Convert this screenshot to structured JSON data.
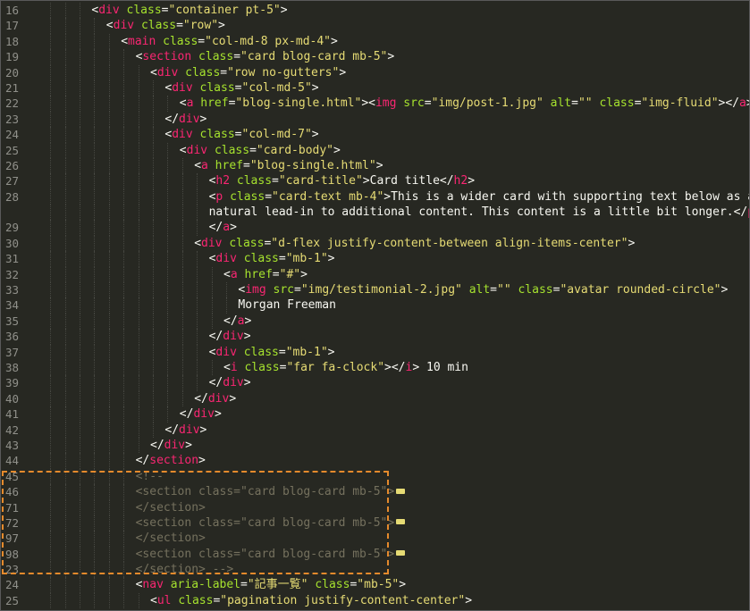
{
  "editor": {
    "lines": [
      {
        "num": "16",
        "indent": 7,
        "segments": [
          [
            "text",
            "<"
          ],
          [
            "tag",
            "div"
          ],
          [
            "text",
            " "
          ],
          [
            "attr",
            "class"
          ],
          [
            "text",
            "="
          ],
          [
            "str",
            "\"container pt-5\""
          ],
          [
            "text",
            ">"
          ]
        ]
      },
      {
        "num": "17",
        "indent": 9,
        "segments": [
          [
            "text",
            "<"
          ],
          [
            "tag",
            "div"
          ],
          [
            "text",
            " "
          ],
          [
            "attr",
            "class"
          ],
          [
            "text",
            "="
          ],
          [
            "str",
            "\"row\""
          ],
          [
            "text",
            ">"
          ]
        ]
      },
      {
        "num": "18",
        "indent": 11,
        "segments": [
          [
            "text",
            "<"
          ],
          [
            "tag",
            "main"
          ],
          [
            "text",
            " "
          ],
          [
            "attr",
            "class"
          ],
          [
            "text",
            "="
          ],
          [
            "str",
            "\"col-md-8 px-md-4\""
          ],
          [
            "text",
            ">"
          ]
        ]
      },
      {
        "num": "19",
        "indent": 13,
        "segments": [
          [
            "text",
            "<"
          ],
          [
            "tag",
            "section"
          ],
          [
            "text",
            " "
          ],
          [
            "attr",
            "class"
          ],
          [
            "text",
            "="
          ],
          [
            "str",
            "\"card blog-card mb-5\""
          ],
          [
            "text",
            ">"
          ]
        ]
      },
      {
        "num": "20",
        "indent": 15,
        "segments": [
          [
            "text",
            "<"
          ],
          [
            "tag",
            "div"
          ],
          [
            "text",
            " "
          ],
          [
            "attr",
            "class"
          ],
          [
            "text",
            "="
          ],
          [
            "str",
            "\"row no-gutters\""
          ],
          [
            "text",
            ">"
          ]
        ]
      },
      {
        "num": "21",
        "indent": 17,
        "segments": [
          [
            "text",
            "<"
          ],
          [
            "tag",
            "div"
          ],
          [
            "text",
            " "
          ],
          [
            "attr",
            "class"
          ],
          [
            "text",
            "="
          ],
          [
            "str",
            "\"col-md-5\""
          ],
          [
            "text",
            ">"
          ]
        ]
      },
      {
        "num": "22",
        "indent": 19,
        "segments": [
          [
            "text",
            "<"
          ],
          [
            "tag",
            "a"
          ],
          [
            "text",
            " "
          ],
          [
            "attr",
            "href"
          ],
          [
            "text",
            "="
          ],
          [
            "str",
            "\"blog-single.html\""
          ],
          [
            "text",
            ">"
          ],
          [
            "text",
            "<"
          ],
          [
            "tag",
            "img"
          ],
          [
            "text",
            " "
          ],
          [
            "attr",
            "src"
          ],
          [
            "text",
            "="
          ],
          [
            "str",
            "\"img/post-1.jpg\""
          ],
          [
            "text",
            " "
          ],
          [
            "attr",
            "alt"
          ],
          [
            "text",
            "="
          ],
          [
            "str",
            "\"\""
          ],
          [
            "text",
            " "
          ],
          [
            "attr",
            "class"
          ],
          [
            "text",
            "="
          ],
          [
            "str",
            "\"img-fluid\""
          ],
          [
            "text",
            ">"
          ],
          [
            "text",
            "</"
          ],
          [
            "tag",
            "a"
          ],
          [
            "text",
            ">"
          ]
        ]
      },
      {
        "num": "23",
        "indent": 17,
        "segments": [
          [
            "text",
            "</"
          ],
          [
            "tag",
            "div"
          ],
          [
            "text",
            ">"
          ]
        ]
      },
      {
        "num": "24",
        "indent": 17,
        "segments": [
          [
            "text",
            "<"
          ],
          [
            "tag",
            "div"
          ],
          [
            "text",
            " "
          ],
          [
            "attr",
            "class"
          ],
          [
            "text",
            "="
          ],
          [
            "str",
            "\"col-md-7\""
          ],
          [
            "text",
            ">"
          ]
        ]
      },
      {
        "num": "25",
        "indent": 19,
        "segments": [
          [
            "text",
            "<"
          ],
          [
            "tag",
            "div"
          ],
          [
            "text",
            " "
          ],
          [
            "attr",
            "class"
          ],
          [
            "text",
            "="
          ],
          [
            "str",
            "\"card-body\""
          ],
          [
            "text",
            ">"
          ]
        ]
      },
      {
        "num": "26",
        "indent": 21,
        "segments": [
          [
            "text",
            "<"
          ],
          [
            "tag",
            "a"
          ],
          [
            "text",
            " "
          ],
          [
            "attr",
            "href"
          ],
          [
            "text",
            "="
          ],
          [
            "str",
            "\"blog-single.html\""
          ],
          [
            "text",
            ">"
          ]
        ]
      },
      {
        "num": "27",
        "indent": 23,
        "segments": [
          [
            "text",
            "<"
          ],
          [
            "tag",
            "h2"
          ],
          [
            "text",
            " "
          ],
          [
            "attr",
            "class"
          ],
          [
            "text",
            "="
          ],
          [
            "str",
            "\"card-title\""
          ],
          [
            "text",
            ">Card title</"
          ],
          [
            "tag",
            "h2"
          ],
          [
            "text",
            ">"
          ]
        ]
      },
      {
        "num": "28",
        "indent": 23,
        "segments": [
          [
            "text",
            "<"
          ],
          [
            "tag",
            "p"
          ],
          [
            "text",
            " "
          ],
          [
            "attr",
            "class"
          ],
          [
            "text",
            "="
          ],
          [
            "str",
            "\"card-text mb-4\""
          ],
          [
            "text",
            ">This is a wider card with supporting text below as a"
          ]
        ]
      },
      {
        "num": "",
        "indent": 23,
        "segments": [
          [
            "text",
            "natural lead-in to additional content. This content is a little bit longer.</"
          ],
          [
            "tag",
            "p"
          ],
          [
            "text",
            ">"
          ]
        ]
      },
      {
        "num": "29",
        "indent": 23,
        "segments": [
          [
            "text",
            "</"
          ],
          [
            "tag",
            "a"
          ],
          [
            "text",
            ">"
          ]
        ]
      },
      {
        "num": "30",
        "indent": 21,
        "segments": [
          [
            "text",
            "<"
          ],
          [
            "tag",
            "div"
          ],
          [
            "text",
            " "
          ],
          [
            "attr",
            "class"
          ],
          [
            "text",
            "="
          ],
          [
            "str",
            "\"d-flex justify-content-between align-items-center\""
          ],
          [
            "text",
            ">"
          ]
        ]
      },
      {
        "num": "31",
        "indent": 23,
        "segments": [
          [
            "text",
            "<"
          ],
          [
            "tag",
            "div"
          ],
          [
            "text",
            " "
          ],
          [
            "attr",
            "class"
          ],
          [
            "text",
            "="
          ],
          [
            "str",
            "\"mb-1\""
          ],
          [
            "text",
            ">"
          ]
        ]
      },
      {
        "num": "32",
        "indent": 25,
        "segments": [
          [
            "text",
            "<"
          ],
          [
            "tag",
            "a"
          ],
          [
            "text",
            " "
          ],
          [
            "attr",
            "href"
          ],
          [
            "text",
            "="
          ],
          [
            "str",
            "\"#\""
          ],
          [
            "text",
            ">"
          ]
        ]
      },
      {
        "num": "33",
        "indent": 27,
        "segments": [
          [
            "text",
            "<"
          ],
          [
            "tag",
            "img"
          ],
          [
            "text",
            " "
          ],
          [
            "attr",
            "src"
          ],
          [
            "text",
            "="
          ],
          [
            "str",
            "\"img/testimonial-2.jpg\""
          ],
          [
            "text",
            " "
          ],
          [
            "attr",
            "alt"
          ],
          [
            "text",
            "="
          ],
          [
            "str",
            "\"\""
          ],
          [
            "text",
            " "
          ],
          [
            "attr",
            "class"
          ],
          [
            "text",
            "="
          ],
          [
            "str",
            "\"avatar rounded-circle\""
          ],
          [
            "text",
            ">"
          ]
        ]
      },
      {
        "num": "34",
        "indent": 27,
        "segments": [
          [
            "text",
            "Morgan Freeman"
          ]
        ]
      },
      {
        "num": "35",
        "indent": 25,
        "segments": [
          [
            "text",
            "</"
          ],
          [
            "tag",
            "a"
          ],
          [
            "text",
            ">"
          ]
        ]
      },
      {
        "num": "36",
        "indent": 23,
        "segments": [
          [
            "text",
            "</"
          ],
          [
            "tag",
            "div"
          ],
          [
            "text",
            ">"
          ]
        ]
      },
      {
        "num": "37",
        "indent": 23,
        "segments": [
          [
            "text",
            "<"
          ],
          [
            "tag",
            "div"
          ],
          [
            "text",
            " "
          ],
          [
            "attr",
            "class"
          ],
          [
            "text",
            "="
          ],
          [
            "str",
            "\"mb-1\""
          ],
          [
            "text",
            ">"
          ]
        ]
      },
      {
        "num": "38",
        "indent": 25,
        "segments": [
          [
            "text",
            "<"
          ],
          [
            "tag",
            "i"
          ],
          [
            "text",
            " "
          ],
          [
            "attr",
            "class"
          ],
          [
            "text",
            "="
          ],
          [
            "str",
            "\"far fa-clock\""
          ],
          [
            "text",
            ">"
          ],
          [
            "text",
            "</"
          ],
          [
            "tag",
            "i"
          ],
          [
            "text",
            "> 10 min"
          ]
        ]
      },
      {
        "num": "39",
        "indent": 23,
        "segments": [
          [
            "text",
            "</"
          ],
          [
            "tag",
            "div"
          ],
          [
            "text",
            ">"
          ]
        ]
      },
      {
        "num": "40",
        "indent": 21,
        "segments": [
          [
            "text",
            "</"
          ],
          [
            "tag",
            "div"
          ],
          [
            "text",
            ">"
          ]
        ]
      },
      {
        "num": "41",
        "indent": 19,
        "segments": [
          [
            "text",
            "</"
          ],
          [
            "tag",
            "div"
          ],
          [
            "text",
            ">"
          ]
        ]
      },
      {
        "num": "42",
        "indent": 17,
        "segments": [
          [
            "text",
            "</"
          ],
          [
            "tag",
            "div"
          ],
          [
            "text",
            ">"
          ]
        ]
      },
      {
        "num": "43",
        "indent": 15,
        "segments": [
          [
            "text",
            "</"
          ],
          [
            "tag",
            "div"
          ],
          [
            "text",
            ">"
          ]
        ]
      },
      {
        "num": "44",
        "indent": 13,
        "segments": [
          [
            "text",
            "</"
          ],
          [
            "tag",
            "section"
          ],
          [
            "text",
            ">"
          ]
        ]
      },
      {
        "num": "45",
        "indent": 13,
        "segments": [
          [
            "cmt",
            "<!--"
          ]
        ]
      },
      {
        "num": "46",
        "indent": 13,
        "segments": [
          [
            "cmt",
            "<section class=\"card blog-card mb-5\">"
          ],
          [
            "fold",
            ""
          ]
        ]
      },
      {
        "num": "71",
        "indent": 13,
        "segments": [
          [
            "cmt",
            "</section>"
          ]
        ]
      },
      {
        "num": "72",
        "indent": 13,
        "segments": [
          [
            "cmt",
            "<section class=\"card blog-card mb-5\">"
          ],
          [
            "fold",
            ""
          ]
        ]
      },
      {
        "num": "97",
        "indent": 13,
        "segments": [
          [
            "cmt",
            "</section>"
          ]
        ]
      },
      {
        "num": "98",
        "indent": 13,
        "segments": [
          [
            "cmt",
            "<section class=\"card blog-card mb-5\">"
          ],
          [
            "fold",
            ""
          ]
        ]
      },
      {
        "num": "23",
        "indent": 13,
        "segments": [
          [
            "cmt",
            "</section> -->"
          ]
        ]
      },
      {
        "num": "24",
        "indent": 13,
        "segments": [
          [
            "text",
            "<"
          ],
          [
            "tag",
            "nav"
          ],
          [
            "text",
            " "
          ],
          [
            "attr",
            "aria-label"
          ],
          [
            "text",
            "="
          ],
          [
            "str",
            "\"記事一覧\""
          ],
          [
            "text",
            " "
          ],
          [
            "attr",
            "class"
          ],
          [
            "text",
            "="
          ],
          [
            "str",
            "\"mb-5\""
          ],
          [
            "text",
            ">"
          ]
        ]
      },
      {
        "num": "25",
        "indent": 15,
        "segments": [
          [
            "text",
            "<"
          ],
          [
            "tag",
            "ul"
          ],
          [
            "text",
            " "
          ],
          [
            "attr",
            "class"
          ],
          [
            "text",
            "="
          ],
          [
            "str",
            "\"pagination justify-content-center\""
          ],
          [
            "text",
            ">"
          ]
        ]
      }
    ]
  }
}
